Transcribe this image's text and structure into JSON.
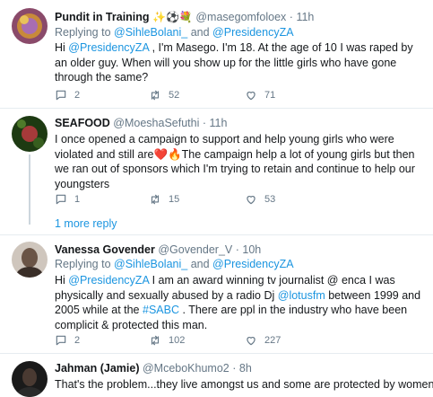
{
  "tweets": [
    {
      "name": "Pundit in Training",
      "name_emoji": "✨⚽💐",
      "handle": "@masegomfoloex",
      "sep": "·",
      "time": "11h",
      "reply_prefix": "Replying to",
      "reply_1": "@SihleBolani_",
      "reply_and": "and",
      "reply_2": "@PresidencyZA",
      "text_pre": "Hi ",
      "text_mention": "@PresidencyZA",
      "text_post": " , I'm Masego. I'm 18. At the age of 10 I was raped by an older guy. When will you show up for the little girls who have gone through the same?",
      "replies": "2",
      "retweets": "52",
      "likes": "71"
    },
    {
      "name": "SEAFOOD",
      "handle": "@MoeshaSefuthi",
      "sep": "·",
      "time": "11h",
      "text_pre": "I once opened a campaign to support and help young girls who were violated and still are",
      "text_emoji": "❤️🔥",
      "text_post": "The campaign help a lot of young girls but then we ran out of sponsors which I'm trying to retain and continue to help our youngsters",
      "replies": "1",
      "retweets": "15",
      "likes": "53",
      "more_replies": "1 more reply"
    },
    {
      "name": "Vanessa Govender",
      "handle": "@Govender_V",
      "sep": "·",
      "time": "10h",
      "reply_prefix": "Replying to",
      "reply_1": "@SihleBolani_",
      "reply_and": "and",
      "reply_2": "@PresidencyZA",
      "text_a": "Hi ",
      "text_m1": "@PresidencyZA",
      "text_b": " I am an award winning tv journalist @ enca I was physically and sexually abused by a radio Dj ",
      "text_m2": "@lotusfm",
      "text_c": " between 1999 and 2005 while at the ",
      "text_m3": "#SABC",
      "text_d": " . There are ppl in the industry who have been complicit & protected this man.",
      "replies": "2",
      "retweets": "102",
      "likes": "227"
    },
    {
      "name": "Jahman (Jamie)",
      "handle": "@MceboKhumo2",
      "sep": "·",
      "time": "8h",
      "text": "That's the problem...they live amongst us and some are protected by women"
    }
  ],
  "icons": {
    "reply": "reply-icon",
    "retweet": "retweet-icon",
    "like": "heart-icon"
  },
  "colors": {
    "link": "#1b95e0",
    "muted": "#657786",
    "divider": "#e6ecf0",
    "thread_line": "#ccd6dd"
  }
}
